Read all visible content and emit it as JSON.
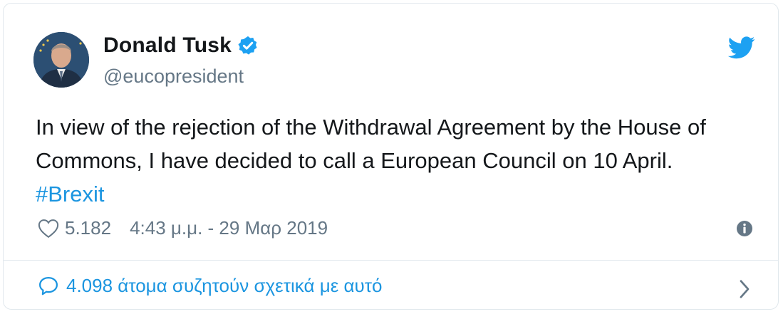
{
  "author": {
    "name": "Donald Tusk",
    "handle": "@eucopresident",
    "verified": true,
    "avatar_icon": "avatar-photo"
  },
  "tweet": {
    "text": "In view of the rejection of the Withdrawal Agreement by the House of Commons, I have decided to call a European Council on 10 April.",
    "hashtag": "#Brexit"
  },
  "meta": {
    "likes": "5.182",
    "timestamp": "4:43 μ.μ. - 29 Μαρ 2019"
  },
  "discussion": {
    "label": "4.098 άτομα συζητούν σχετικά με αυτό"
  },
  "colors": {
    "accent": "#1b95e0",
    "twitter_blue": "#1da1f2",
    "secondary_text": "#657786",
    "border": "#e1e8ed"
  },
  "icons": [
    "verified-badge-icon",
    "twitter-bird-icon",
    "heart-icon",
    "info-icon",
    "speech-bubble-icon",
    "chevron-right-icon"
  ]
}
